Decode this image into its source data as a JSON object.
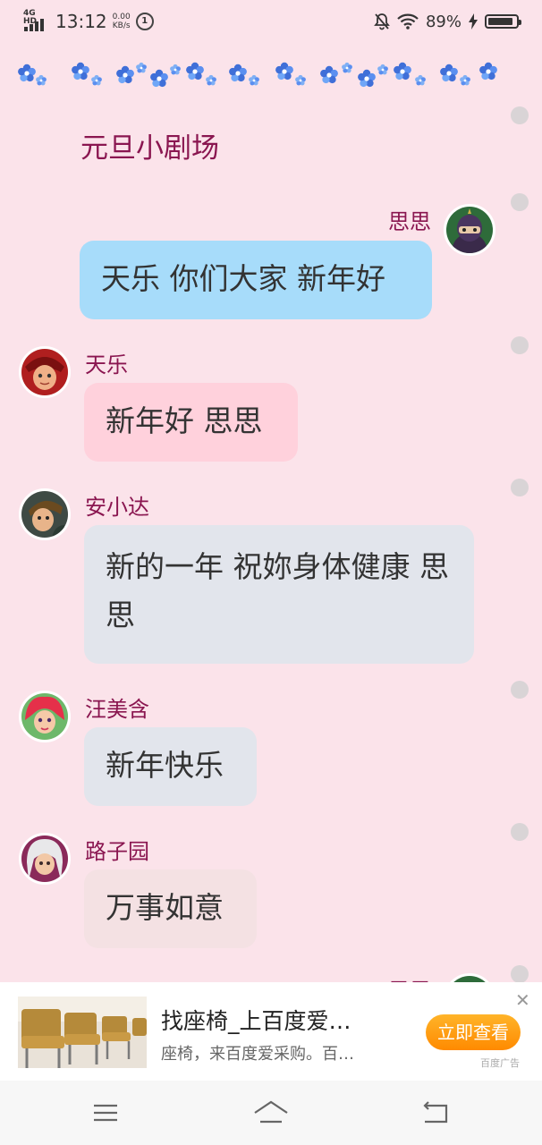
{
  "status_bar": {
    "network": "4G HD",
    "time": "13:12",
    "speed_value": "0.00",
    "speed_unit": "KB/s",
    "circle_label": "1",
    "battery": "89%",
    "battery_level": 0.89
  },
  "scene_title": "元旦小剧场",
  "messages": [
    {
      "sender": "思思",
      "text": "天乐 你们大家 新年好",
      "align": "right",
      "color": "#a7dcfa"
    },
    {
      "sender": "天乐",
      "text": "新年好 思思",
      "align": "left",
      "color": "#ffd1dc"
    },
    {
      "sender": "安小达",
      "text": "新的一年 祝妳身体健康 思思",
      "align": "left",
      "color": "#e2e5ec"
    },
    {
      "sender": "汪美含",
      "text": "新年快乐",
      "align": "left",
      "color": "#e2e5ec"
    },
    {
      "sender": "路子园",
      "text": "万事如意",
      "align": "left",
      "color": "#f4e1e3"
    },
    {
      "sender": "思思",
      "text": "",
      "align": "right",
      "color": "#a7dcfa"
    }
  ],
  "ad": {
    "title": "找座椅_上百度爱…",
    "description": "座椅，来百度爱采购。百…",
    "button": "立即查看",
    "close": "✕",
    "tag": "百度广告"
  },
  "colors": {
    "background": "#fbe3ea",
    "name": "#8a1650",
    "ad_button": "#ff9a14"
  }
}
